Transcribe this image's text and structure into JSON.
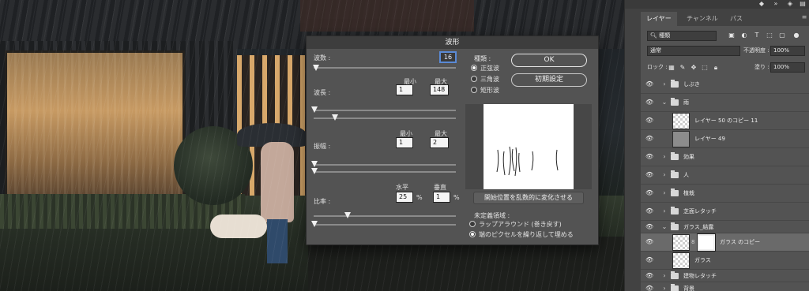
{
  "dialog": {
    "title": "波形",
    "generators_label": "波数 :",
    "generators_value": "16",
    "wavelength": {
      "label": "波長 :",
      "min_label": "最小",
      "max_label": "最大",
      "min": "1",
      "max": "148"
    },
    "amplitude": {
      "label": "振幅 :",
      "min_label": "最小",
      "max_label": "最大",
      "min": "1",
      "max": "2"
    },
    "scale": {
      "label": "比率 :",
      "h_label": "水平",
      "v_label": "垂直",
      "h": "25",
      "v": "1",
      "unit": "%"
    },
    "type": {
      "label": "種類 :",
      "options": [
        "正弦波",
        "三角波",
        "矩形波"
      ],
      "selected": 0
    },
    "ok_label": "OK",
    "defaults_label": "初期設定",
    "randomize_label": "開始位置を乱数的に変化させる",
    "undefined": {
      "label": "未定義領域 :",
      "options": [
        "ラップアラウンド (巻き戻す)",
        "端のピクセルを繰り返して埋める"
      ],
      "selected": 1
    }
  },
  "panel": {
    "tabs": [
      "レイヤー",
      "チャンネル",
      "パス"
    ],
    "filter_kind": "種類",
    "blend_mode": "通常",
    "opacity_label": "不透明度 :",
    "opacity_value": "100%",
    "lock_label": "ロック :",
    "fill_label": "塗り :",
    "fill_value": "100%",
    "layers": [
      {
        "name": "しぶき",
        "kind": "group",
        "expanded": false
      },
      {
        "name": "雨",
        "kind": "group",
        "expanded": true
      },
      {
        "name": "レイヤー 50 のコピー 11",
        "kind": "layer"
      },
      {
        "name": "レイヤー 49",
        "kind": "layer"
      },
      {
        "name": "効果",
        "kind": "group",
        "expanded": false
      },
      {
        "name": "人",
        "kind": "group",
        "expanded": false
      },
      {
        "name": "植栽",
        "kind": "group",
        "expanded": false
      },
      {
        "name": "芝面レタッチ",
        "kind": "group",
        "expanded": false
      },
      {
        "name": "ガラス_結露",
        "kind": "group",
        "expanded": true
      },
      {
        "name": "ガラス のコピー",
        "kind": "layer",
        "selected": true
      },
      {
        "name": "ガラス",
        "kind": "layer"
      },
      {
        "name": "建物レタッチ",
        "kind": "group",
        "expanded": false
      },
      {
        "name": "背景",
        "kind": "group",
        "expanded": false
      }
    ]
  },
  "icons": {
    "eye": "👁",
    "caret_closed": "›",
    "caret_open": "⌄",
    "link": "8"
  }
}
